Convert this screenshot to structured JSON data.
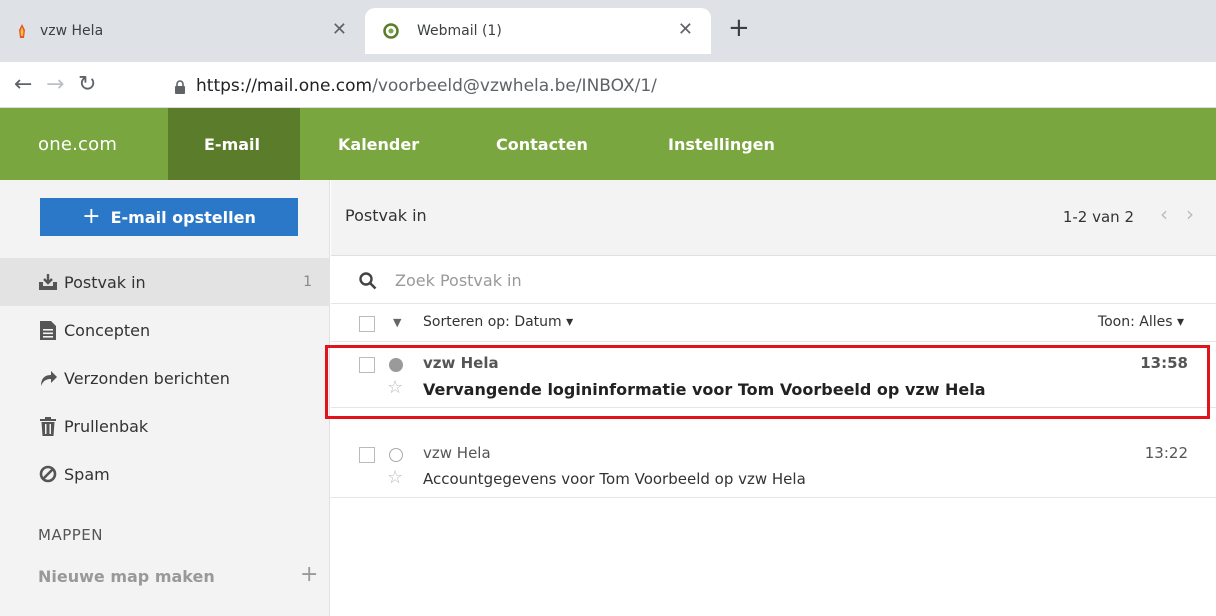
{
  "browser": {
    "tabs": [
      {
        "title": "vzw Hela",
        "active": false
      },
      {
        "title": "Webmail (1)",
        "active": true
      }
    ],
    "url_host": "https://mail.one.com",
    "url_path": "/voorbeeld@vzwhela.be/INBOX/1/"
  },
  "topnav": {
    "brand": "one.com",
    "items": [
      "E-mail",
      "Kalender",
      "Contacten",
      "Instellingen"
    ],
    "active": "E-mail"
  },
  "sidebar": {
    "compose_label": "E-mail opstellen",
    "items": [
      {
        "label": "Postvak in",
        "count": "1",
        "icon": "inbox-icon"
      },
      {
        "label": "Concepten",
        "icon": "drafts-icon"
      },
      {
        "label": "Verzonden berichten",
        "icon": "sent-icon"
      },
      {
        "label": "Prullenbak",
        "icon": "trash-icon"
      },
      {
        "label": "Spam",
        "icon": "spam-icon"
      }
    ],
    "folders_heading": "MAPPEN",
    "new_folder_label": "Nieuwe map maken"
  },
  "main": {
    "folder_title": "Postvak in",
    "pager": "1-2 van 2",
    "search_placeholder": "Zoek Postvak in",
    "sort_label": "Sorteren op: Datum ▾",
    "show_filter": "Toon: Alles ▾",
    "messages": [
      {
        "sender": "vzw Hela",
        "subject": "Vervangende logininformatie voor Tom Voorbeeld op vzw Hela",
        "time": "13:58",
        "unread": true
      },
      {
        "sender": "vzw Hela",
        "subject": "Accountgegevens voor Tom Voorbeeld op vzw Hela",
        "time": "13:22",
        "unread": false
      }
    ]
  },
  "colors": {
    "nav_green": "#7aa63f",
    "nav_active": "#5a7c2b",
    "compose_blue": "#2c78c8",
    "highlight_red": "#e0141a"
  }
}
